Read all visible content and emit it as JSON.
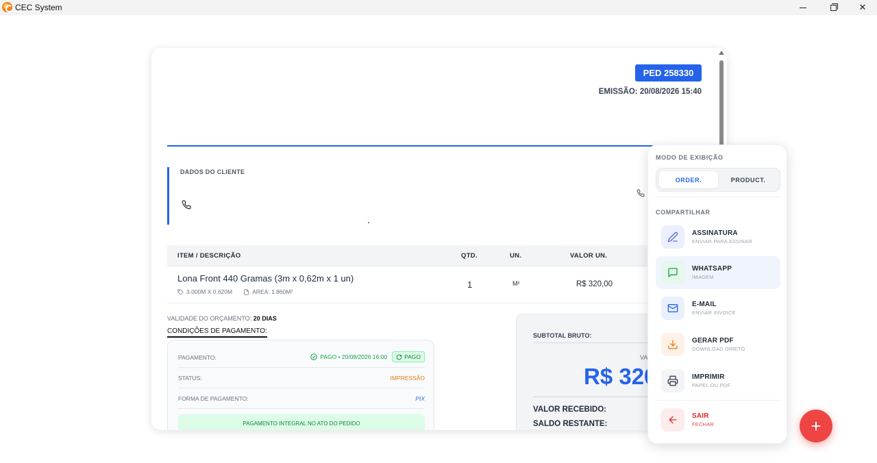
{
  "window": {
    "title": "CEC System",
    "controls": {
      "minimize_icon": "minimize-icon",
      "maximize_icon": "restore-icon",
      "close_glyph": "✕"
    }
  },
  "document": {
    "order_badge": "PED 258330",
    "emission": "EMISSÃO: 20/08/2026 15:40",
    "client_section_label": "DADOS DO CLIENTE",
    "table": {
      "headers": [
        "ITEM / DESCRIÇÃO",
        "QTD.",
        "UN.",
        "VALOR UN."
      ],
      "rows": [
        {
          "description": "Lona Front 440 Gramas (3m x 0,62m x 1 un)",
          "dimensions": "3.000M X 0.620M",
          "area": "AREA: 1.860M²",
          "qty": "1",
          "unit": "M²",
          "unit_price": "R$ 320,00"
        }
      ]
    },
    "validity_label": "VALIDADE DO ORÇAMENTO:",
    "validity_value": "20 DIAS",
    "payment_conditions_title": "CONDIÇÕES DE PAGAMENTO:",
    "payment": {
      "payment_label": "PAGAMENTO:",
      "payment_value": "PAGO • 20/08/2026 16:00",
      "payment_pill": "PAGO",
      "status_label": "STATUS:",
      "status_value": "IMPRESSÃO",
      "method_label": "FORMA DE PAGAMENTO:",
      "method_value": "PIX",
      "note": "PAGAMENTO INTEGRAL NO ATO DO PEDIDO"
    },
    "totals": {
      "subtotal_label": "SUBTOTAL BRUTO:",
      "partial_label": "VA",
      "total_amount": "R$ 320",
      "received_label": "VALOR RECEBIDO:",
      "remaining_label": "SALDO RESTANTE:"
    }
  },
  "panel": {
    "display_mode_title": "MODO DE EXIBIÇÃO",
    "mode_options": [
      "ORDER.",
      "PRODUCT."
    ],
    "selected_mode": "ORDER.",
    "share_title": "COMPARTILHAR",
    "actions": [
      {
        "title": "ASSINATURA",
        "subtitle": "ENVIAR PARA ASSINAR",
        "icon": "pen-icon",
        "color": "#5b6be0"
      },
      {
        "title": "WHATSAPP",
        "subtitle": "IMAGEM",
        "icon": "chat-icon",
        "color": "#16a34a"
      },
      {
        "title": "E-MAIL",
        "subtitle": "ENVIAR INVOICE",
        "icon": "mail-icon",
        "color": "#2563eb"
      },
      {
        "title": "GERAR PDF",
        "subtitle": "DOWNLOAD DIRETO",
        "icon": "download-icon",
        "color": "#ea7a16"
      },
      {
        "title": "IMPRIMIR",
        "subtitle": "PAPEL OU PDF",
        "icon": "printer-icon",
        "color": "#374151"
      },
      {
        "title": "SAIR",
        "subtitle": "FECHAR",
        "icon": "arrow-left-icon",
        "color": "#dc2626"
      }
    ]
  },
  "fab": {
    "glyph": "+",
    "color": "#ef4444"
  }
}
